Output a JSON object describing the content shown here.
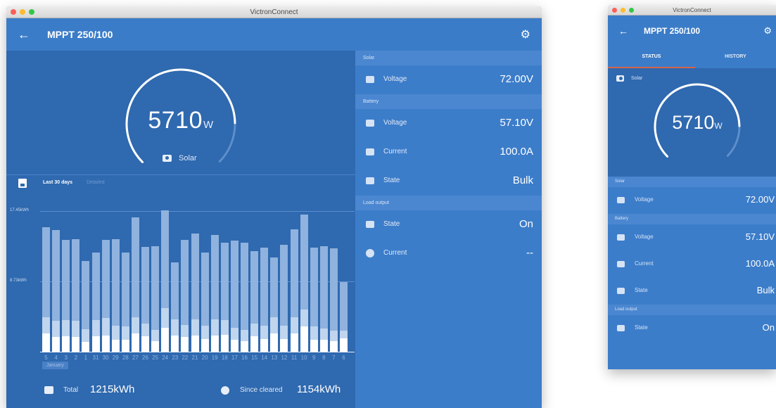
{
  "main_window": {
    "title": "VictronConnect",
    "device_name": "MPPT 250/100",
    "gauge": {
      "value": "5710",
      "unit": "W",
      "label": "Solar",
      "fraction": 0.83
    },
    "history_tabs": {
      "active": "Last 30 days",
      "inactive": "Detailed"
    },
    "chart_data": {
      "type": "bar",
      "y_ticks": [
        "17.45kWh",
        "8.73kWh"
      ],
      "ylim": [
        0,
        17.45
      ],
      "x_labels": [
        "5",
        "4",
        "3",
        "2",
        "1",
        "31",
        "30",
        "29",
        "28",
        "27",
        "26",
        "25",
        "24",
        "23",
        "22",
        "21",
        "20",
        "19",
        "18",
        "17",
        "16",
        "15",
        "14",
        "13",
        "12",
        "11",
        "10",
        "9",
        "8",
        "7",
        "6"
      ],
      "month_label": "January",
      "series": [
        {
          "values": [
            2.3,
            1.8,
            1.9,
            1.8,
            1.2,
            1.9,
            2.0,
            1.5,
            1.5,
            2.3,
            1.9,
            1.3,
            3.0,
            2.0,
            1.8,
            2.0,
            1.6,
            2.0,
            2.1,
            1.5,
            1.3,
            1.9,
            1.6,
            2.3,
            1.6,
            2.3,
            3.1,
            1.5,
            1.5,
            1.3,
            1.7
          ]
        },
        {
          "values": [
            2.0,
            2.0,
            2.0,
            2.0,
            1.6,
            2.0,
            2.2,
            1.7,
            1.6,
            2.0,
            1.6,
            1.4,
            2.4,
            2.0,
            1.5,
            2.0,
            1.6,
            2.0,
            1.8,
            1.5,
            1.4,
            1.6,
            1.6,
            2.0,
            1.6,
            2.0,
            2.1,
            1.6,
            1.4,
            1.3,
            0.9
          ]
        },
        {
          "values": [
            11.1,
            11.3,
            10.0,
            10.2,
            8.5,
            8.4,
            9.7,
            10.8,
            9.2,
            12.4,
            9.5,
            10.4,
            12.1,
            7.1,
            10.6,
            10.7,
            9.1,
            10.5,
            9.6,
            10.8,
            10.8,
            9.0,
            9.7,
            7.4,
            10.1,
            10.9,
            11.8,
            9.8,
            10.2,
            10.2,
            6.0
          ]
        }
      ]
    },
    "totals": {
      "total_label": "Total",
      "total_value": "1215kWh",
      "since_label": "Since cleared",
      "since_value": "1154kWh"
    },
    "sections": [
      {
        "title": "Solar",
        "rows": [
          {
            "label": "Voltage",
            "value": "72.00V"
          }
        ]
      },
      {
        "title": "Battery",
        "rows": [
          {
            "label": "Voltage",
            "value": "57.10V"
          },
          {
            "label": "Current",
            "value": "100.0A"
          },
          {
            "label": "State",
            "value": "Bulk"
          }
        ]
      },
      {
        "title": "Load output",
        "rows": [
          {
            "label": "State",
            "value": "On"
          },
          {
            "label": "Current",
            "value": "--"
          }
        ]
      }
    ]
  },
  "small_window": {
    "title": "VictronConnect",
    "device_name": "MPPT 250/100",
    "tabs": [
      "STATUS",
      "HISTORY"
    ],
    "solar_label": "Solar",
    "gauge": {
      "value": "5710",
      "unit": "W",
      "fraction": 0.83
    },
    "sections": [
      {
        "title": "Solar",
        "rows": [
          {
            "label": "Voltage",
            "value": "72.00V"
          }
        ]
      },
      {
        "title": "Battery",
        "rows": [
          {
            "label": "Voltage",
            "value": "57.10V"
          },
          {
            "label": "Current",
            "value": "100.0A"
          },
          {
            "label": "State",
            "value": "Bulk"
          }
        ]
      },
      {
        "title": "Load output",
        "rows": [
          {
            "label": "State",
            "value": "On"
          }
        ]
      }
    ]
  },
  "colors": {
    "bar_dark": "#ffffff",
    "bar_mid": "#c0d5ee",
    "bar_light": "#8fb2de",
    "gauge_arc": "#ffffff",
    "gauge_track": "#5d8fcc",
    "tab_indicator": "#d8634a"
  },
  "icons": {
    "back": "arrow-left-icon",
    "settings": "gear-icon",
    "save": "floppy-disk-icon",
    "solar": "solar-panel-icon",
    "battery": "battery-icon",
    "state": "dots-icon",
    "bulb": "lightbulb-icon"
  }
}
